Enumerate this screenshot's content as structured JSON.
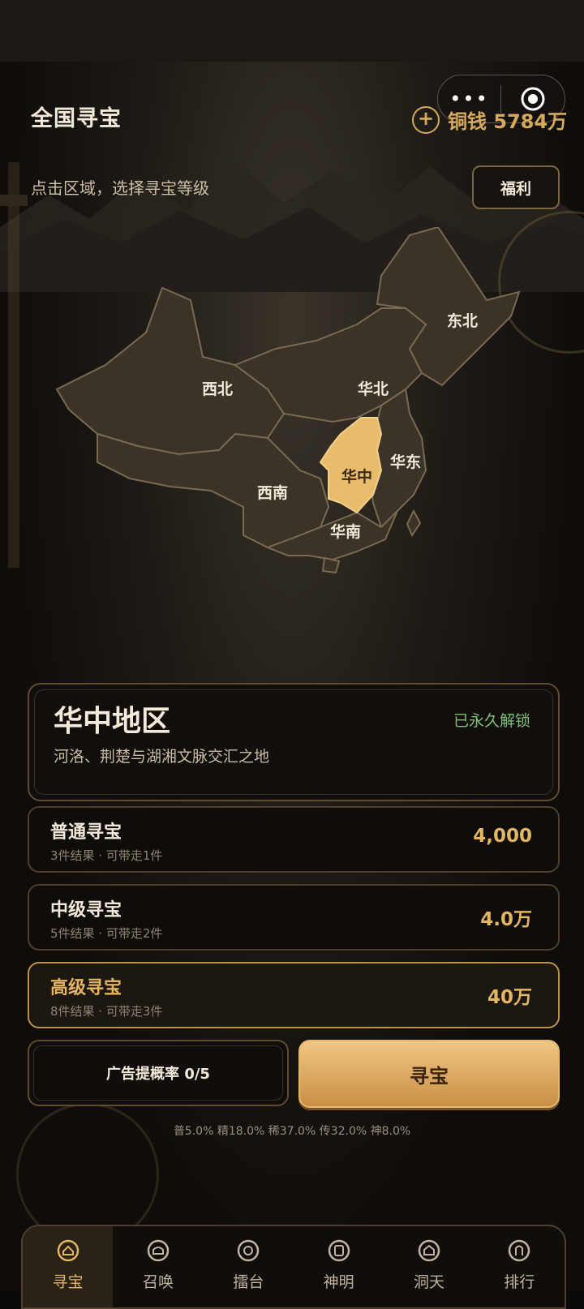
{
  "header": {
    "title": "全国寻宝",
    "subtitle": "点击区域，选择寻宝等级",
    "currency_label": "铜钱 5784万",
    "welfare_button": "福利",
    "capsule_more": "•••"
  },
  "map": {
    "regions": [
      {
        "key": "northwest",
        "label": "西北"
      },
      {
        "key": "north",
        "label": "华北"
      },
      {
        "key": "northeast",
        "label": "东北"
      },
      {
        "key": "east",
        "label": "华东"
      },
      {
        "key": "central",
        "label": "华中",
        "selected": true
      },
      {
        "key": "southwest",
        "label": "西南"
      },
      {
        "key": "south",
        "label": "华南"
      }
    ],
    "colors": {
      "region_fill": "#3b3328",
      "region_stroke": "#7a6a52",
      "selected_fill": "#e8bc6c"
    }
  },
  "region_card": {
    "name": "华中地区",
    "description": "河洛、荆楚与湖湘文脉交汇之地",
    "status": "已永久解锁"
  },
  "tiers": [
    {
      "name": "普通寻宝",
      "desc": "3件结果 · 可带走1件",
      "price": "4,000",
      "selected": false
    },
    {
      "name": "中级寻宝",
      "desc": "5件结果 · 可带走2件",
      "price": "4.0万",
      "selected": false
    },
    {
      "name": "高级寻宝",
      "desc": "8件结果 · 可带走3件",
      "price": "40万",
      "selected": true
    }
  ],
  "actions": {
    "ad_button": "广告提概率 0/5",
    "hunt_button": "寻宝"
  },
  "probabilities": "普5.0%  精18.0%  稀37.0%  传32.0%  神8.0%",
  "tabbar": [
    {
      "label": "寻宝",
      "icon": "treasure-icon",
      "active": true
    },
    {
      "label": "召唤",
      "icon": "summon-icon",
      "active": false
    },
    {
      "label": "擂台",
      "icon": "arena-icon",
      "active": false
    },
    {
      "label": "神明",
      "icon": "deity-icon",
      "active": false
    },
    {
      "label": "洞天",
      "icon": "cave-icon",
      "active": false
    },
    {
      "label": "排行",
      "icon": "rank-icon",
      "active": false
    }
  ],
  "colors": {
    "accent_gold": "#e3b661",
    "unlocked_green": "#7fbf7a"
  }
}
